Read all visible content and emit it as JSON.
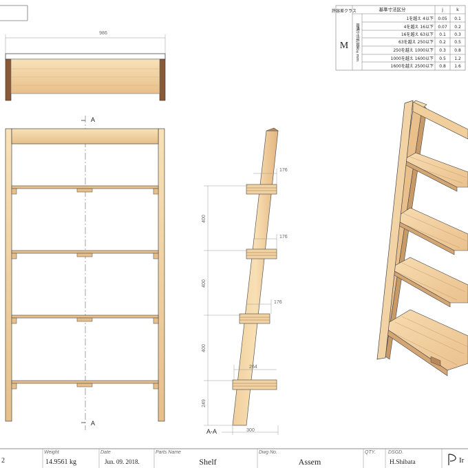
{
  "top_view": {
    "width_dim": "986"
  },
  "section_marks": {
    "top": "A",
    "bottom": "A",
    "view_label": "A-A"
  },
  "side_view": {
    "depth_dims": [
      "176",
      "176",
      "176",
      "264"
    ],
    "spacing_dims": [
      "400",
      "400",
      "400",
      "249"
    ],
    "base_dim": "300"
  },
  "tolerance_table": {
    "col_header_class": "許容差クラス",
    "col_header_range": "基準寸法区分",
    "col_j": "j",
    "col_k": "k",
    "class_letter": "M",
    "side_label": "普通寸法許容差±mm",
    "rows": [
      {
        "range": "1を越え 4以下",
        "j": "0.05",
        "k": "0.1"
      },
      {
        "range": "4を越え 16以下",
        "j": "0.07",
        "k": "0.2"
      },
      {
        "range": "16を越え 63以下",
        "j": "0.1",
        "k": "0.3"
      },
      {
        "range": "63を越え 250以下",
        "j": "0.2",
        "k": "0.5"
      },
      {
        "range": "250を越え 1000以下",
        "j": "0.3",
        "k": "0.8"
      },
      {
        "range": "1000を越え 1600以下",
        "j": "0.5",
        "k": "1.2"
      },
      {
        "range": "1600を越え 2500以下",
        "j": "0.8",
        "k": "1.6"
      }
    ]
  },
  "title_block": {
    "scale_partial": "2",
    "weight_label": "Weight",
    "weight_value": "14.9561 kg",
    "date_label": "Date",
    "date_value": "Jun. 09. 2018.",
    "parts_label": "Parts Name",
    "parts_value": "Shelf",
    "dwg_label": "Dwg No.",
    "dwg_value": "Assem",
    "qty_label": "QTY.",
    "dsgd_label": "DSGD.",
    "dsgd_value": "H.Shibata",
    "logo_text": "Ir"
  },
  "colors": {
    "wood_light": "#f6e6ba",
    "wood_mid": "#e0b47e",
    "wood_dark": "#8a5a38",
    "line": "#555555"
  }
}
